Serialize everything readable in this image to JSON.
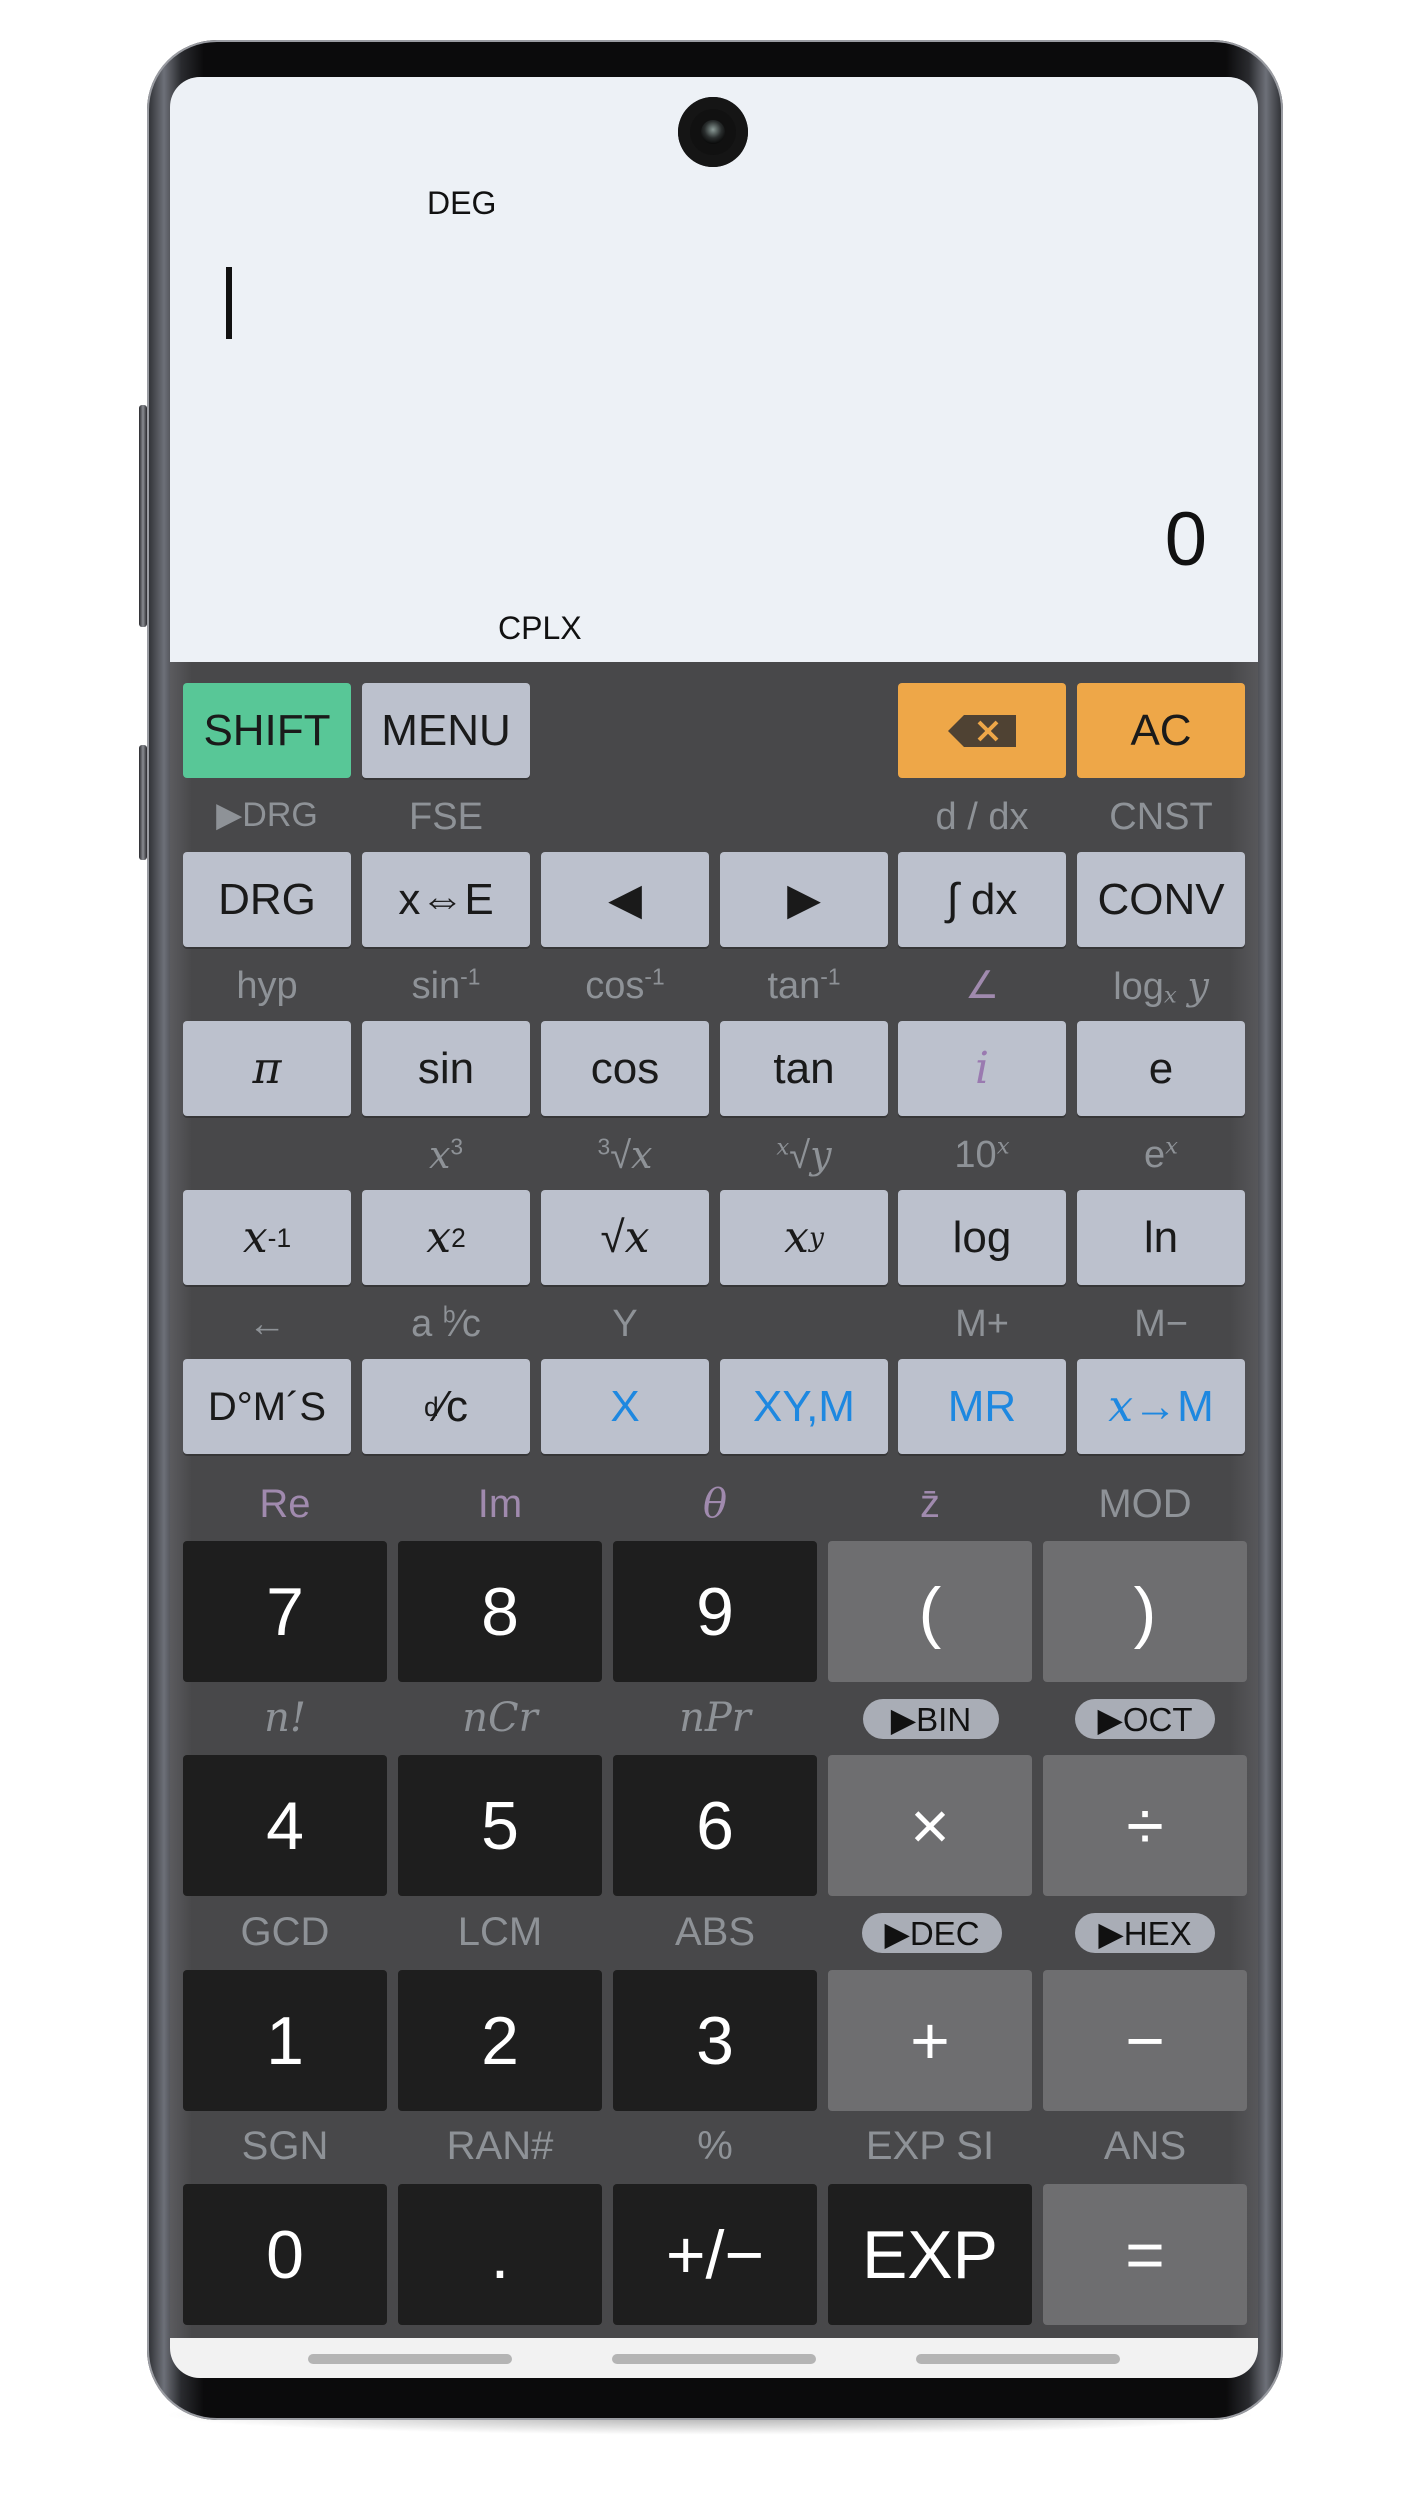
{
  "display": {
    "angle_mode": "DEG",
    "complex_mode": "CPLX",
    "input": "",
    "result": "0"
  },
  "top_row": {
    "shift": "SHIFT",
    "menu": "MENU",
    "backspace_icon": "backspace-icon",
    "ac": "AC"
  },
  "row1_labels": [
    "▶DRG",
    "FSE",
    "",
    "",
    "d / dx",
    "CNST"
  ],
  "row1_keys": [
    "DRG",
    "x⇔E",
    "◀",
    "▶",
    "∫ dx",
    "CONV"
  ],
  "row2_labels": [
    "hyp",
    "sin-1",
    "cos-1",
    "tan-1",
    "∠",
    "logx y"
  ],
  "row2_keys": [
    "π",
    "sin",
    "cos",
    "tan",
    "i",
    "e"
  ],
  "row3_labels": [
    "",
    "x3",
    "3√x",
    "x√y",
    "10x",
    "ex"
  ],
  "row3_keys": [
    "x-1",
    "x2",
    "√x",
    "xy",
    "log",
    "ln"
  ],
  "row4_labels": [
    "←",
    "a b/c",
    "Y",
    "",
    "M+",
    "M−"
  ],
  "row4_keys": [
    "D°M´S",
    "d/c",
    "X",
    "XY,M",
    "MR",
    "x→M"
  ],
  "num_rows": [
    {
      "labels": [
        "Re",
        "Im",
        "θ",
        "z̄",
        "MOD"
      ],
      "keys": [
        "7",
        "8",
        "9",
        "(",
        ")"
      ]
    },
    {
      "labels": [
        "n!",
        "nCr",
        "nPr",
        "▶BIN",
        "▶OCT"
      ],
      "keys": [
        "4",
        "5",
        "6",
        "×",
        "÷"
      ]
    },
    {
      "labels": [
        "GCD",
        "LCM",
        "ABS",
        "▶DEC",
        "▶HEX"
      ],
      "keys": [
        "1",
        "2",
        "3",
        "+",
        "−"
      ]
    },
    {
      "labels": [
        "SGN",
        "RAN#",
        "%",
        "EXP SI",
        "ANS"
      ],
      "keys": [
        "0",
        ".",
        "+/−",
        "EXP",
        "="
      ]
    }
  ],
  "colors": {
    "shift": "#58c797",
    "function_key": "#bcc1cd",
    "clear_keys": "#eea748",
    "digit_key": "#1e1e1e",
    "operator_key": "#6e6e70",
    "secondary_label": "#8e9297",
    "complex_label": "#a08aae",
    "memory_key_text": "#1e88e0",
    "display_bg": "#edf1f6",
    "keyboard_bg": "#48484a"
  }
}
